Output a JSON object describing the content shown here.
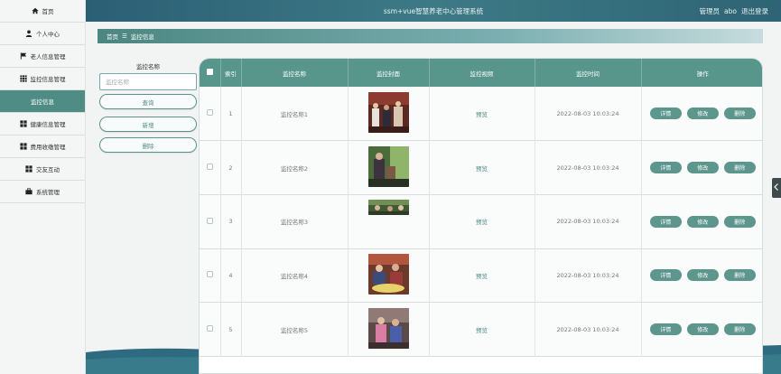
{
  "header": {
    "title": "ssm+vue智慧养老中心管理系统",
    "user_role": "管理员",
    "username": "abo",
    "logout": "退出登录"
  },
  "sidebar": {
    "items": [
      {
        "label": "首页",
        "icon": "home-icon",
        "active": false
      },
      {
        "label": "个人中心",
        "icon": "user-icon",
        "active": false
      },
      {
        "label": "老人信息管理",
        "icon": "flag-icon",
        "active": false
      },
      {
        "label": "监控信息管理",
        "icon": "grid-icon",
        "active": false
      },
      {
        "label": "监控信息",
        "icon": "",
        "active": true
      },
      {
        "label": "健康信息管理",
        "icon": "grid-icon",
        "active": false
      },
      {
        "label": "费用收缴管理",
        "icon": "grid-icon",
        "active": false
      },
      {
        "label": "交友互动",
        "icon": "grid-icon",
        "active": false
      },
      {
        "label": "系统管理",
        "icon": "briefcase-icon",
        "active": false
      }
    ]
  },
  "breadcrumb": {
    "home": "首页",
    "separator": "☰",
    "current": "监控信息"
  },
  "search": {
    "label": "监控名称",
    "placeholder": "监控名称",
    "query_button": "查询",
    "add_button": "新增",
    "delete_button": "删除"
  },
  "table": {
    "columns": [
      "",
      "索引",
      "监控名称",
      "监控封面",
      "监控视频",
      "监控时间",
      "操作"
    ],
    "rows": [
      {
        "index": "1",
        "name": "监控名称1",
        "video": "预览",
        "time": "2022-08-03 10:03:24"
      },
      {
        "index": "2",
        "name": "监控名称2",
        "video": "预览",
        "time": "2022-08-03 10:03:24"
      },
      {
        "index": "3",
        "name": "监控名称3",
        "video": "预览",
        "time": "2022-08-03 10:03:24"
      },
      {
        "index": "4",
        "name": "监控名称4",
        "video": "预览",
        "time": "2022-08-03 10:03:24"
      },
      {
        "index": "5",
        "name": "监控名称5",
        "video": "预览",
        "time": "2022-08-03 10:03:24"
      }
    ],
    "actions": {
      "detail": "详情",
      "edit": "修改",
      "delete": "删除"
    }
  },
  "colors": {
    "accent": "#58968c",
    "header_bg": "#2e6474",
    "sidebar_active": "#4f8c84"
  }
}
